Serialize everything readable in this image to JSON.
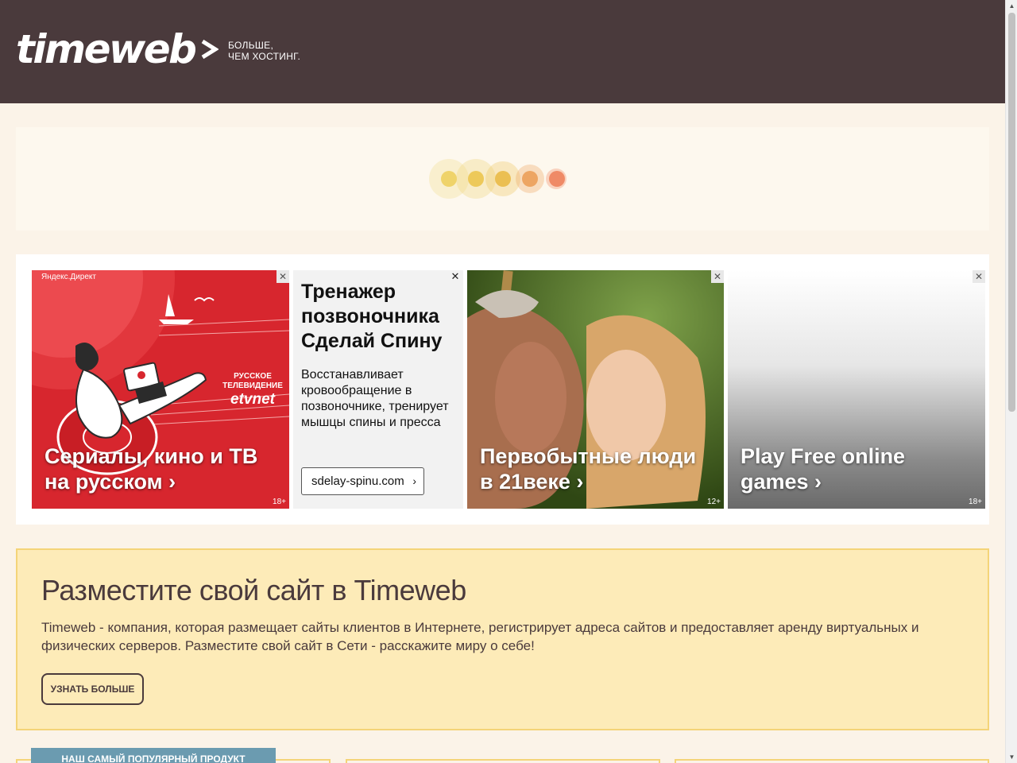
{
  "header": {
    "logo_text": "timeweb",
    "tagline_line1": "БОЛЬШЕ,",
    "tagline_line2": "ЧЕМ ХОСТИНГ."
  },
  "colors": {
    "header_bg": "#4a3a3c",
    "page_bg": "#fbf3e8",
    "promo_bg": "#fdebb8",
    "promo_border": "#f4d478",
    "popular_tab": "#6b9bb0"
  },
  "ads": {
    "direct_label": "Яндекс.Директ",
    "close_icon": "close-icon",
    "items": [
      {
        "title_line1": "Сериалы, кино и ТВ",
        "title_line2": "на русском ›",
        "age": "18+",
        "brand_line1": "РУССКОЕ",
        "brand_line2": "ТЕЛЕВИДЕНИЕ",
        "brand_name": "etvnet"
      },
      {
        "title": "Тренажер позвоночника Сделай Спину",
        "body": "Восстанавливает кровообращение в позвоночнике, тренирует мышцы спины и пресса",
        "domain": "sdelay-spinu.com"
      },
      {
        "title_line1": "Первобытные люди",
        "title_line2": "в 21веке ›",
        "age": "12+"
      },
      {
        "title_line1": "Play Free online",
        "title_line2": "games ›",
        "age": "18+"
      }
    ]
  },
  "promo": {
    "title": "Разместите свой сайт в Timeweb",
    "text": "Timeweb - компания, которая размещает сайты клиентов в Интернете, регистрирует адреса сайтов и предоставляет аренду виртуальных и физических серверов. Разместите свой сайт в Сети - расскажите миру о себе!",
    "button": "УЗНАТЬ БОЛЬШЕ"
  },
  "popular_tab": "НАШ САМЫЙ ПОПУЛЯРНЫЙ ПРОДУКТ"
}
